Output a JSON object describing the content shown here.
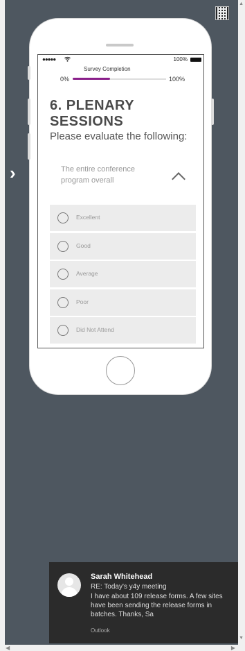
{
  "survey": {
    "progress_label": "Survey Completion",
    "progress_start": "0%",
    "progress_end": "100%",
    "progress_fraction": 0.4,
    "accent_color": "#8a1f8a"
  },
  "status_bar": {
    "signal": "●●●●● ",
    "wifi_icon": "wifi-icon",
    "battery_pct": "100%"
  },
  "section": {
    "title": "6. PLENARY SESSIONS",
    "subtitle": "Please evaluate the following:"
  },
  "question": {
    "text": "The entire conference program overall"
  },
  "options": [
    {
      "label": "Excellent"
    },
    {
      "label": "Good"
    },
    {
      "label": "Average"
    },
    {
      "label": "Poor"
    },
    {
      "label": "Did Not Attend"
    }
  ],
  "notification": {
    "sender": "Sarah Whitehead",
    "subject": "RE: Today's y4y meeting",
    "body": "I have about 109 release forms. A few sites have been sending the release forms in batches.   Thanks,  Sa",
    "app": "Outlook"
  }
}
